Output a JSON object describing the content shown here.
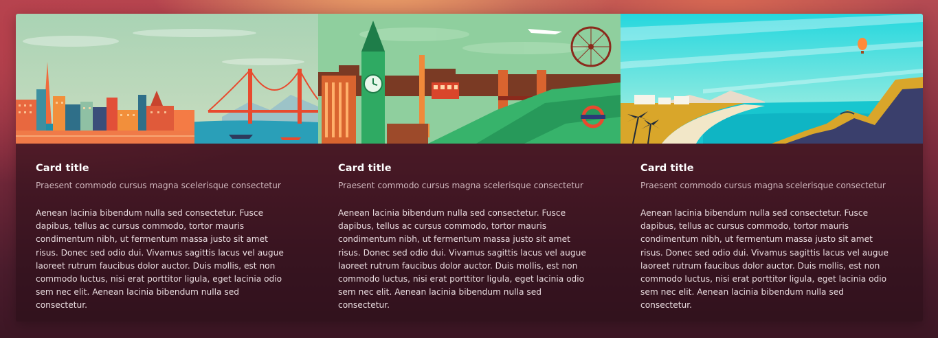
{
  "cards": [
    {
      "image_alt": "San Francisco illustrated skyline",
      "title": "Card title",
      "subtitle": "Praesent commodo cursus magna scelerisque consectetur",
      "text": "Aenean lacinia bibendum nulla sed consectetur. Fusce dapibus, tellus ac cursus commodo, tortor mauris condimentum nibh, ut fermentum massa justo sit amet risus. Donec sed odio dui. Vivamus sagittis lacus vel augue laoreet rutrum faucibus dolor auctor. Duis mollis, est non commodo luctus, nisi erat porttitor ligula, eget lacinia odio sem nec elit. Aenean lacinia bibendum nulla sed consectetur."
    },
    {
      "image_alt": "London illustrated skyline",
      "title": "Card title",
      "subtitle": "Praesent commodo cursus magna scelerisque consectetur",
      "text": "Aenean lacinia bibendum nulla sed consectetur. Fusce dapibus, tellus ac cursus commodo, tortor mauris condimentum nibh, ut fermentum massa justo sit amet risus. Donec sed odio dui. Vivamus sagittis lacus vel augue laoreet rutrum faucibus dolor auctor. Duis mollis, est non commodo luctus, nisi erat porttitor ligula, eget lacinia odio sem nec elit. Aenean lacinia bibendum nulla sed consectetur."
    },
    {
      "image_alt": "Beach coastline illustration",
      "title": "Card title",
      "subtitle": "Praesent commodo cursus magna scelerisque consectetur",
      "text": "Aenean lacinia bibendum nulla sed consectetur. Fusce dapibus, tellus ac cursus commodo, tortor mauris condimentum nibh, ut fermentum massa justo sit amet risus. Donec sed odio dui. Vivamus sagittis lacus vel augue laoreet rutrum faucibus dolor auctor. Duis mollis, est non commodo luctus, nisi erat porttitor ligula, eget lacinia odio sem nec elit. Aenean lacinia bibendum nulla sed consectetur."
    }
  ]
}
